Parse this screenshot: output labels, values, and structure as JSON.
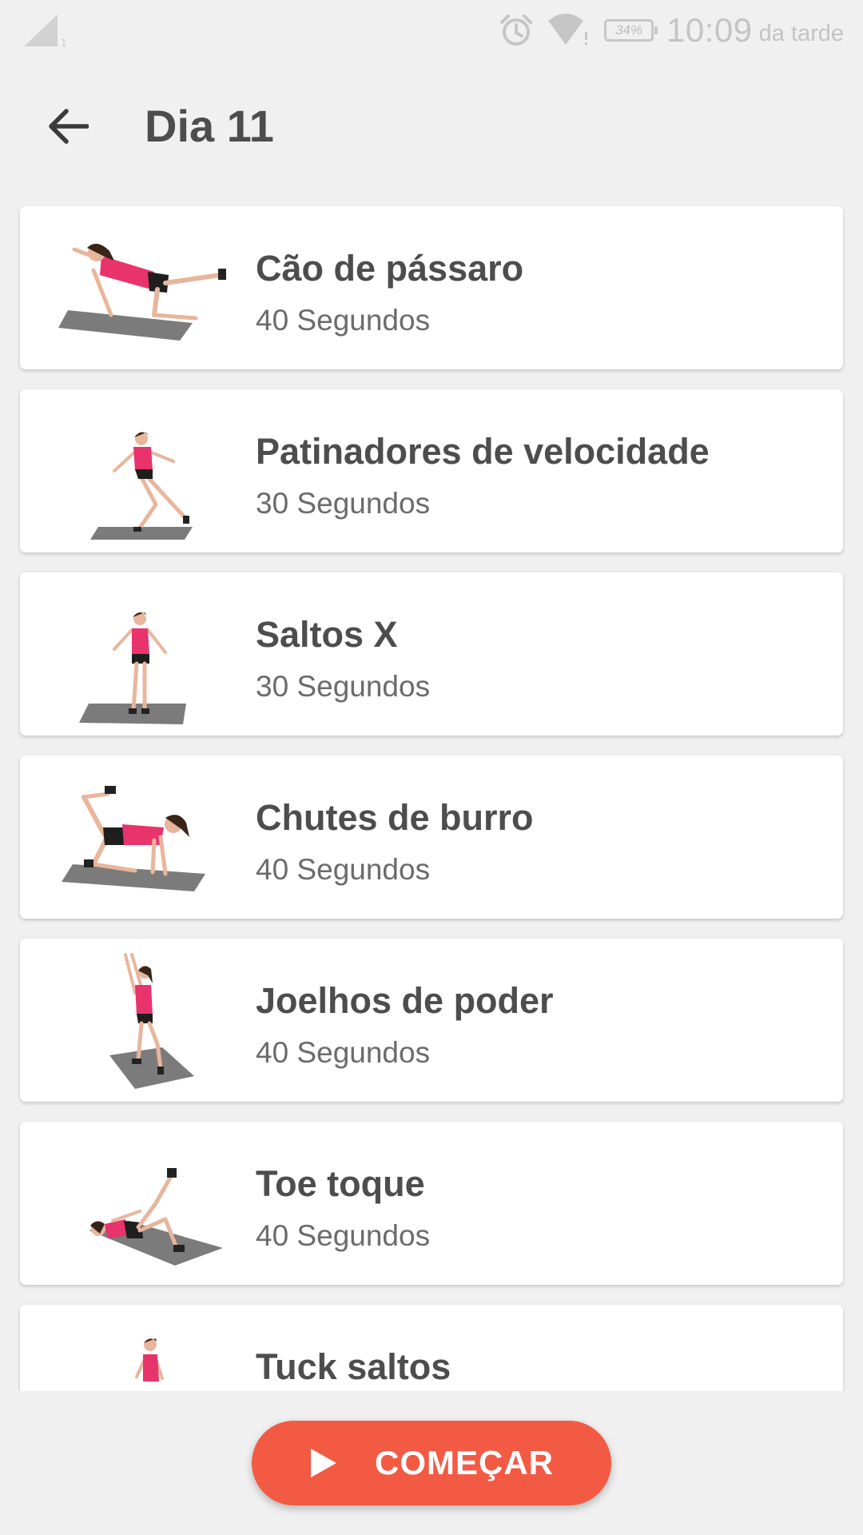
{
  "status_bar": {
    "signal_icon": "signal-icon",
    "alarm_icon": "alarm-icon",
    "wifi_icon": "wifi-icon",
    "battery": "34%",
    "time": "10:09",
    "period": "da tarde"
  },
  "header": {
    "back_icon": "arrow-left-icon",
    "title": "Dia 11"
  },
  "exercises": [
    {
      "name": "Cão de pássaro",
      "duration": "40 Segundos"
    },
    {
      "name": "Patinadores de velocidade",
      "duration": "30 Segundos"
    },
    {
      "name": "Saltos X",
      "duration": "30 Segundos"
    },
    {
      "name": "Chutes de burro",
      "duration": "40 Segundos"
    },
    {
      "name": "Joelhos de poder",
      "duration": "40 Segundos"
    },
    {
      "name": "Toe toque",
      "duration": "40 Segundos"
    },
    {
      "name": "Tuck saltos",
      "duration": ""
    }
  ],
  "start_button": {
    "label": "COMEÇAR",
    "icon": "play-icon"
  },
  "colors": {
    "accent": "#f35a43",
    "background": "#f0f0f0",
    "card": "#ffffff",
    "text_primary": "#4d4d4d",
    "text_secondary": "#6b6b6b",
    "shirt": "#e8336d"
  }
}
